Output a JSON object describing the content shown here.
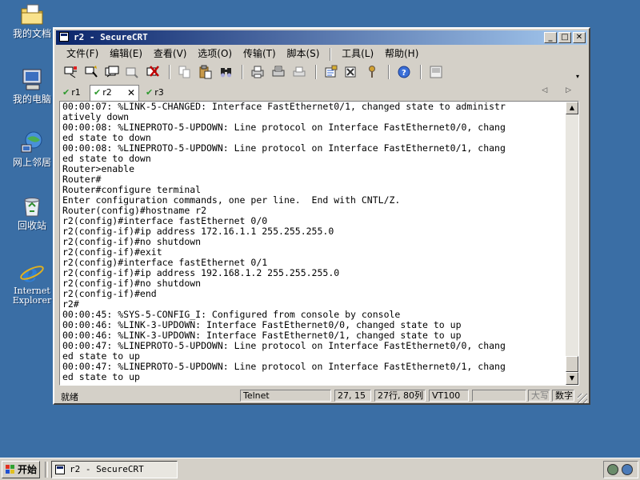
{
  "desktop": {
    "icons": [
      {
        "label": "我的文档",
        "icon": "my-documents-icon"
      },
      {
        "label": "我的电脑",
        "icon": "my-computer-icon"
      },
      {
        "label": "网上邻居",
        "icon": "network-places-icon"
      },
      {
        "label": "回收站",
        "icon": "recycle-bin-icon"
      },
      {
        "label": "Internet Explorer",
        "icon": "internet-explorer-icon"
      }
    ]
  },
  "window": {
    "title": "r2 - SecureCRT",
    "title_gradient": [
      "#0a246a",
      "#a6caf0"
    ],
    "controls": {
      "minimize": "_",
      "maximize": "□",
      "close": "✕"
    }
  },
  "menu": {
    "items": [
      "文件(F)",
      "编辑(E)",
      "查看(V)",
      "选项(O)",
      "传输(T)",
      "脚本(S)",
      "工具(L)",
      "帮助(H)"
    ]
  },
  "toolbar": {
    "icons": [
      "connect-icon",
      "quick-connect-icon",
      "connect-tab-icon",
      "reconnect-icon",
      "disconnect-icon",
      "copy-icon",
      "paste-icon",
      "find-icon",
      "print-icon",
      "print-selection-icon",
      "print-setup-icon",
      "session-options-icon",
      "global-options-icon",
      "keymap-icon",
      "help-icon",
      "log-icon"
    ]
  },
  "tabs": {
    "items": [
      {
        "label": "r1",
        "active": false
      },
      {
        "label": "r2",
        "active": true,
        "close": "✕"
      },
      {
        "label": "r3",
        "active": false
      }
    ],
    "nav": "◁ ▷"
  },
  "terminal": {
    "lines": [
      "00:00:07: %LINK-5-CHANGED: Interface FastEthernet0/1, changed state to administr",
      "atively down",
      "00:00:08: %LINEPROTO-5-UPDOWN: Line protocol on Interface FastEthernet0/0, chang",
      "ed state to down",
      "00:00:08: %LINEPROTO-5-UPDOWN: Line protocol on Interface FastEthernet0/1, chang",
      "ed state to down",
      "Router>enable",
      "Router#",
      "Router#configure terminal",
      "Enter configuration commands, one per line.  End with CNTL/Z.",
      "Router(config)#hostname r2",
      "r2(config)#interface fastEthernet 0/0",
      "r2(config-if)#ip address 172.16.1.1 255.255.255.0",
      "r2(config-if)#no shutdown",
      "r2(config-if)#exit",
      "r2(config)#interface fastEthernet 0/1",
      "r2(config-if)#ip address 192.168.1.2 255.255.255.0",
      "r2(config-if)#no shutdown",
      "r2(config-if)#end",
      "r2#",
      "00:00:45: %SYS-5-CONFIG_I: Configured from console by console",
      "00:00:46: %LINK-3-UPDOWN: Interface FastEthernet0/0, changed state to up",
      "00:00:46: %LINK-3-UPDOWN: Interface FastEthernet0/1, changed state to up",
      "00:00:47: %LINEPROTO-5-UPDOWN: Line protocol on Interface FastEthernet0/0, chang",
      "ed state to up",
      "00:00:47: %LINEPROTO-5-UPDOWN: Line protocol on Interface FastEthernet0/1, chang",
      "ed state to up"
    ]
  },
  "status": {
    "ready": "就绪",
    "protocol": "Telnet",
    "cursor": "27, 15",
    "size": "27行, 80列",
    "terminal_type": "VT100",
    "caps": "大写",
    "num": "数字"
  },
  "taskbar": {
    "start": "开始",
    "task_title": "r2 - SecureCRT"
  },
  "colors": {
    "desktop": "#3a6ea5",
    "chrome": "#d4d0c8",
    "tab_check": "#2f9a2f"
  }
}
